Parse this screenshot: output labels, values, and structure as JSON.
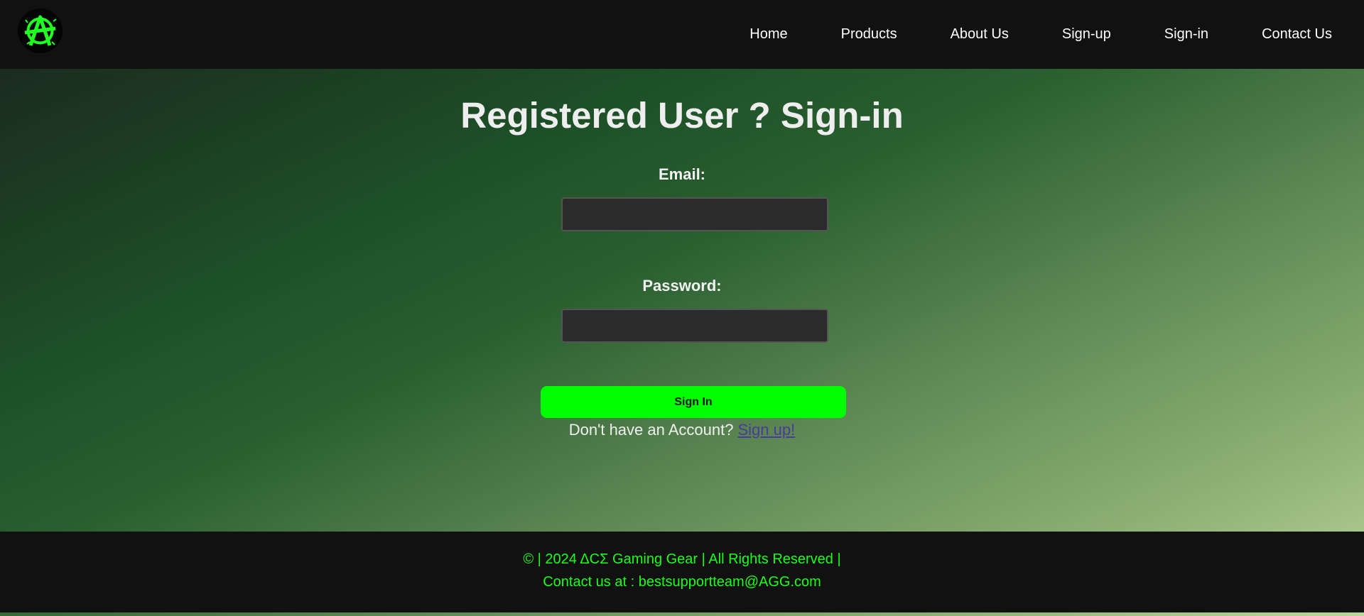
{
  "nav": {
    "logo_icon": "anarchy-symbol-logo-icon",
    "links": [
      "Home",
      "Products",
      "About Us",
      "Sign-up",
      "Sign-in",
      "Contact Us"
    ]
  },
  "main": {
    "title": "Registered User ? Sign-in",
    "email_label": "Email:",
    "email_value": "",
    "password_label": "Password:",
    "password_value": "",
    "signin_button": "Sign In",
    "account_prompt": "Don't have an Account?",
    "signup_link": "Sign up!"
  },
  "footer": {
    "line1": "© | 2024 ΔCΣ Gaming Gear | All Rights Reserved |",
    "line2": "Contact us at : bestsupportteam@AGG.com"
  },
  "colors": {
    "accent": "#00ff00",
    "navbar_bg": "#111111",
    "input_bg": "#2b2b2b",
    "link": "#4b3a9a"
  }
}
